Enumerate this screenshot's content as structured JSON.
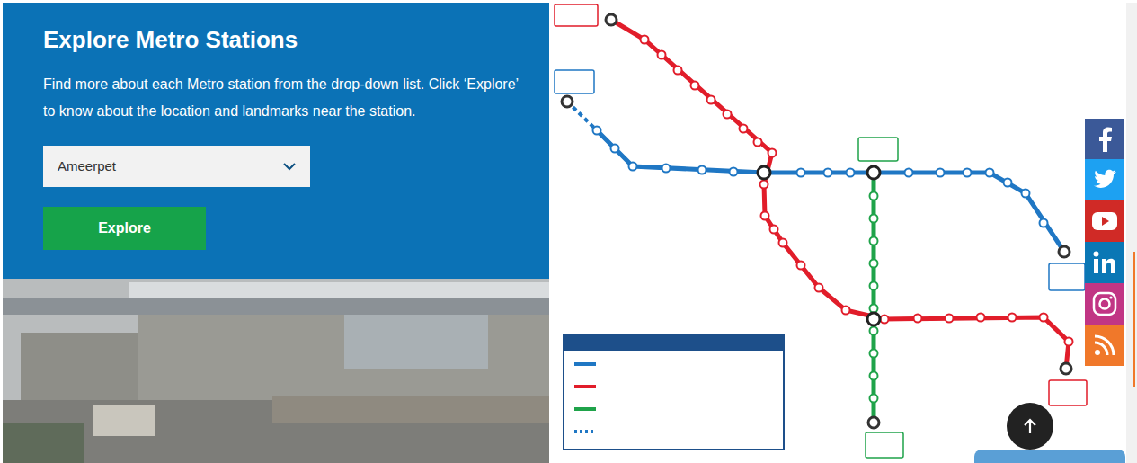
{
  "section": {
    "title": "Explore Metro Stations",
    "description": "Find more about each Metro station from the drop-down list. Click ‘Explore’ to know about the location and landmarks near the station.",
    "station_select": {
      "value": "Ameerpet"
    },
    "button": "Explore"
  }
}
